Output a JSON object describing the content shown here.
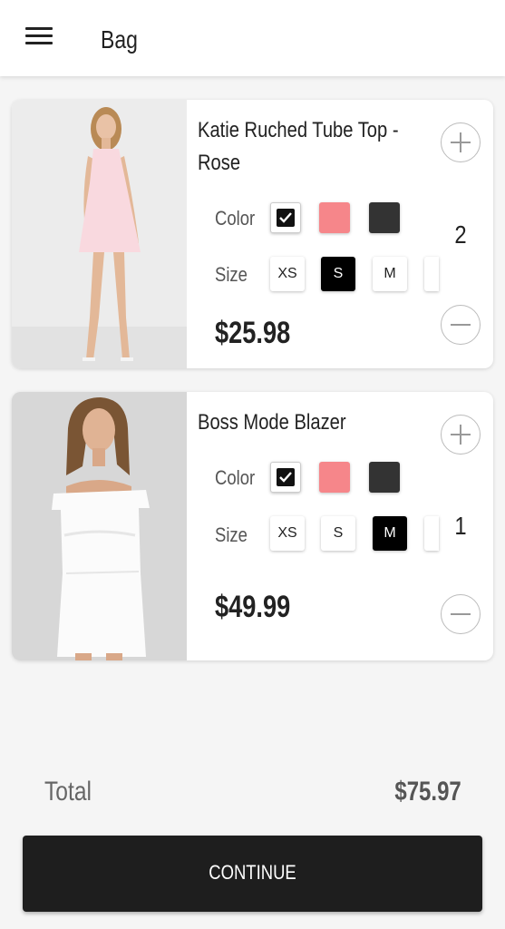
{
  "header": {
    "title": "Bag",
    "menu_icon": "hamburger-menu-icon"
  },
  "items": [
    {
      "name": "Katie Ruched Tube Top - Rose",
      "color_label": "Color",
      "size_label": "Size",
      "colors": [
        "#ffffff",
        "#f6868a",
        "#333333"
      ],
      "selected_color": 0,
      "sizes": [
        "XS",
        "S",
        "M"
      ],
      "selected_size": "S",
      "price": "$25.98",
      "quantity": "2"
    },
    {
      "name": "Boss Mode Blazer",
      "color_label": "Color",
      "size_label": "Size",
      "colors": [
        "#ffffff",
        "#f6868a",
        "#333333"
      ],
      "selected_color": 0,
      "sizes": [
        "XS",
        "S",
        "M"
      ],
      "selected_size": "M",
      "price": "$49.99",
      "quantity": "1"
    }
  ],
  "summary": {
    "total_label": "Total",
    "total_value": "$75.97"
  },
  "continue_label": "CONTINUE"
}
